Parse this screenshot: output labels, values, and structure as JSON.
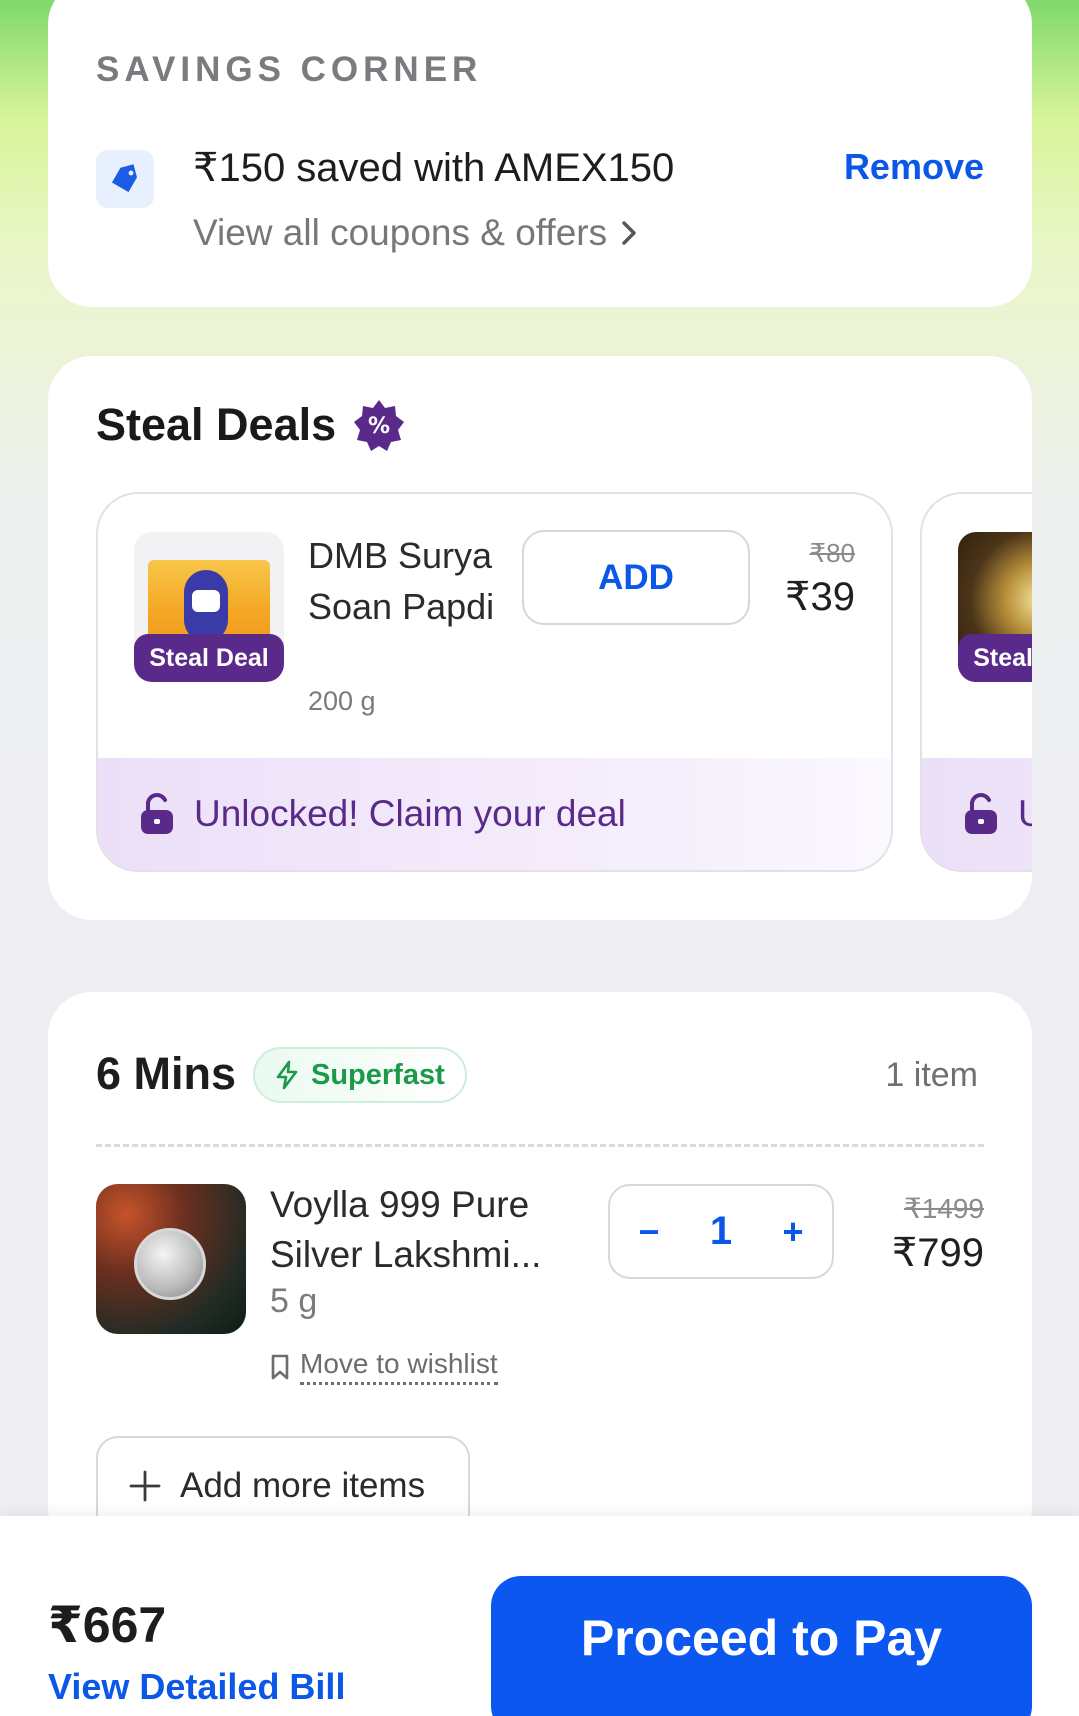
{
  "savings": {
    "heading": "SAVINGS CORNER",
    "coupon_title": "₹150 saved with AMEX150",
    "coupon_link": "View all coupons & offers",
    "remove_label": "Remove"
  },
  "steal_deals": {
    "title": "Steal Deals",
    "badge_icon": "percent-badge-icon",
    "deals": [
      {
        "name": "DMB Surya Soan Papdi",
        "weight": "200 g",
        "tag": "Steal Deal",
        "add_label": "ADD",
        "mrp": "₹80",
        "price": "₹39",
        "unlock_text": "Unlocked! Claim your deal"
      },
      {
        "tag": "Steal Deal",
        "unlock_text": "U"
      }
    ]
  },
  "cart": {
    "eta": "6 Mins",
    "speed_badge": "Superfast",
    "item_count": "1 item",
    "product": {
      "name": "Voylla 999 Pure Silver Lakshmi...",
      "weight": "5 g",
      "wishlist_label": "Move to wishlist",
      "quantity": "1",
      "decrement": "−",
      "increment": "+",
      "mrp": "₹1499",
      "price": "₹799"
    },
    "add_more_label": "Add more items"
  },
  "footer": {
    "total": "₹667",
    "bill_link": "View Detailed Bill",
    "pay_label": "Proceed to Pay"
  },
  "colors": {
    "accent_blue": "#0b57e8",
    "deal_purple": "#5a2a8a",
    "superfast_green": "#1c9a4a"
  }
}
